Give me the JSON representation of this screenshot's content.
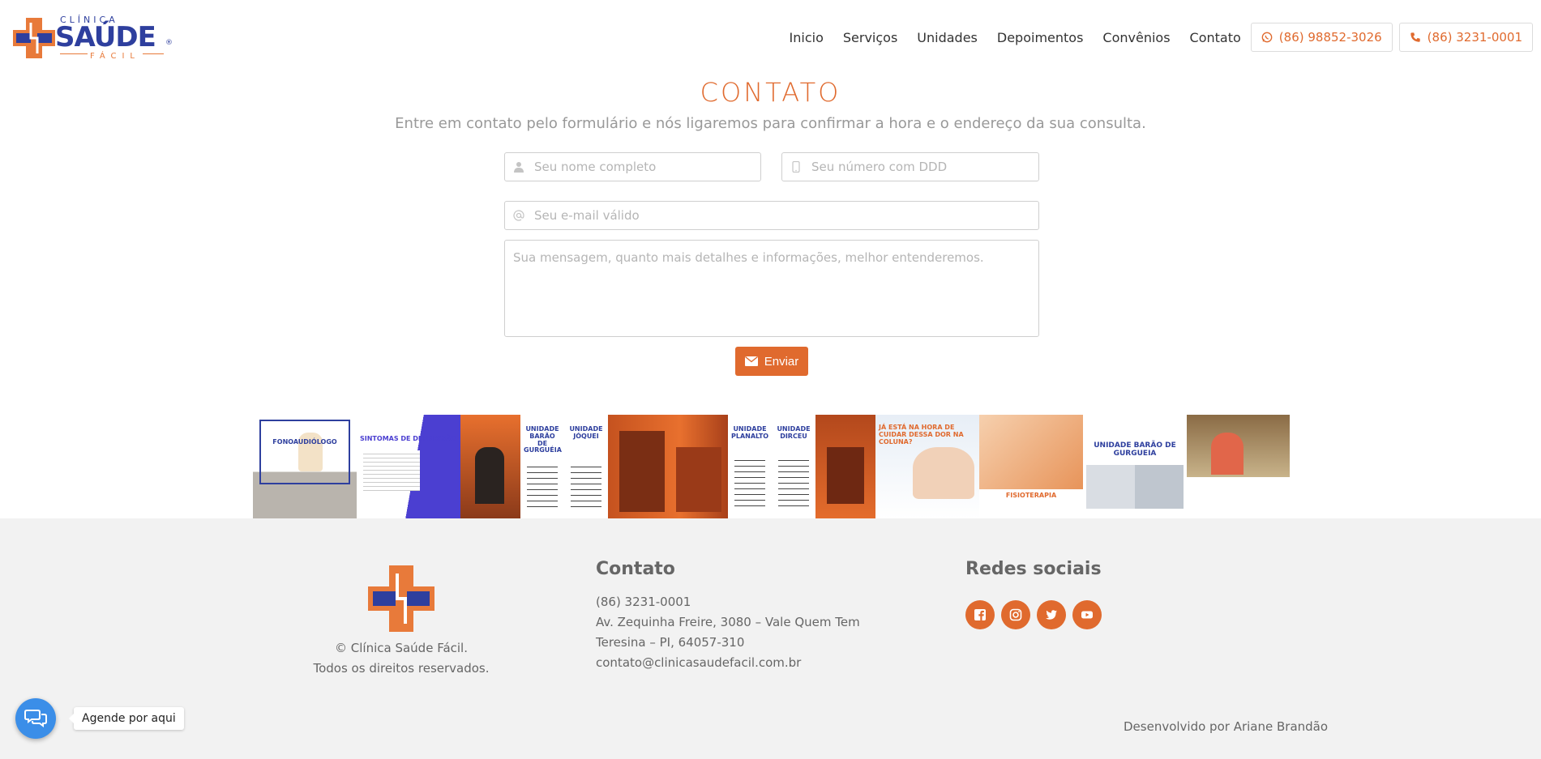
{
  "brand": {
    "name_top": "CLÍNICA",
    "name_main": "SAÚDE",
    "name_bottom": "FÁCIL",
    "registered": "®",
    "colors": {
      "blue": "#2e3f9e",
      "orange": "#e06a2e"
    }
  },
  "nav": {
    "items": [
      "Inicio",
      "Serviços",
      "Unidades",
      "Depoimentos",
      "Convênios",
      "Contato"
    ],
    "whatsapp": {
      "icon": "whatsapp-icon",
      "label": "(86) 98852-3026"
    },
    "phone": {
      "icon": "phone-icon",
      "label": "(86) 3231-0001"
    }
  },
  "contact": {
    "title": "CONTATO",
    "subtitle": "Entre em contato pelo formulário e nós ligaremos para confirmar a hora e o endereço da sua consulta.",
    "name_placeholder": "Seu nome completo",
    "phone_placeholder": "Seu número com DDD",
    "email_placeholder": "Seu e-mail válido",
    "message_placeholder": "Sua mensagem, quanto mais detalhes e informações, melhor entenderemos.",
    "send_label": "Enviar"
  },
  "gallery": {
    "items": [
      {
        "caption": "FONOAUDIÓLOGO"
      },
      {
        "caption": "SINTOMAS DE DEPRESSÃO"
      },
      {
        "caption": ""
      },
      {
        "caption": "UNIDADE BARÃO DE GURGUÉIA"
      },
      {
        "caption": "UNIDADE JÓQUEI"
      },
      {
        "caption": ""
      },
      {
        "caption": "UNIDADE PLANALTO"
      },
      {
        "caption": "UNIDADE DIRCEU"
      },
      {
        "caption": ""
      },
      {
        "caption": "JÁ ESTÁ NA HORA DE CUIDAR DESSA DOR NA COLUNA?"
      },
      {
        "caption": "FISIOTERAPIA"
      },
      {
        "caption": "UNIDADE BARÃO DE GURGUEIA"
      },
      {
        "caption": ""
      }
    ]
  },
  "footer": {
    "copyright": "© Clínica Saúde Fácil.",
    "rights": "Todos os direitos reservados.",
    "contact_title": "Contato",
    "contact_lines": [
      "(86) 3231-0001",
      "Av. Zequinha Freire, 3080 – Vale Quem Tem",
      "Teresina – PI, 64057-310",
      "contato@clinicasaudefacil.com.br"
    ],
    "social_title": "Redes sociais",
    "social": [
      "facebook-icon",
      "instagram-icon",
      "twitter-icon",
      "youtube-icon"
    ],
    "developer": "Desenvolvido por Ariane Brandão"
  },
  "chat": {
    "label": "Agende por aqui"
  }
}
